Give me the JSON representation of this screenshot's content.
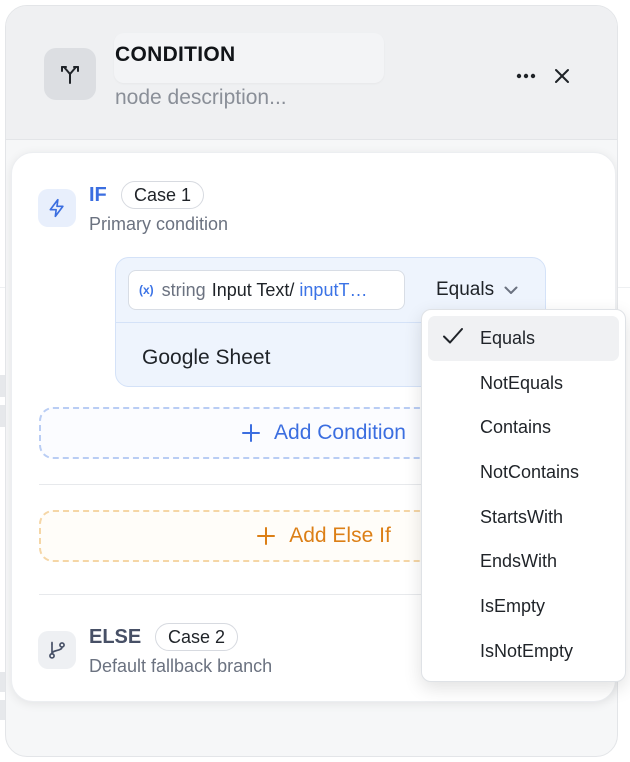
{
  "header": {
    "title": "CONDITION",
    "description_placeholder": "node description...",
    "icon": "branch-icon",
    "more_icon": "more-horizontal-icon",
    "close_icon": "close-icon"
  },
  "if_case": {
    "keyword": "IF",
    "badge": "Case 1",
    "subtitle": "Primary condition",
    "icon": "lightning-icon",
    "condition": {
      "variable_icon": "(x)",
      "variable_type": "string",
      "variable_name": "Input Text/",
      "variable_path": "inputT…",
      "operator": "Equals",
      "value": "Google Sheet"
    },
    "add_condition_label": "Add Condition",
    "add_else_if_label": "Add Else If"
  },
  "else_case": {
    "keyword": "ELSE",
    "badge": "Case 2",
    "subtitle": "Default fallback branch",
    "icon": "git-branch-icon"
  },
  "operator_menu": {
    "selected": "Equals",
    "options": [
      "Equals",
      "NotEquals",
      "Contains",
      "NotContains",
      "StartsWith",
      "EndsWith",
      "IsEmpty",
      "IsNotEmpty"
    ]
  },
  "colors": {
    "if_accent": "#3b6ee0",
    "else_if_accent": "#dc7f16",
    "else_text": "#475066"
  }
}
